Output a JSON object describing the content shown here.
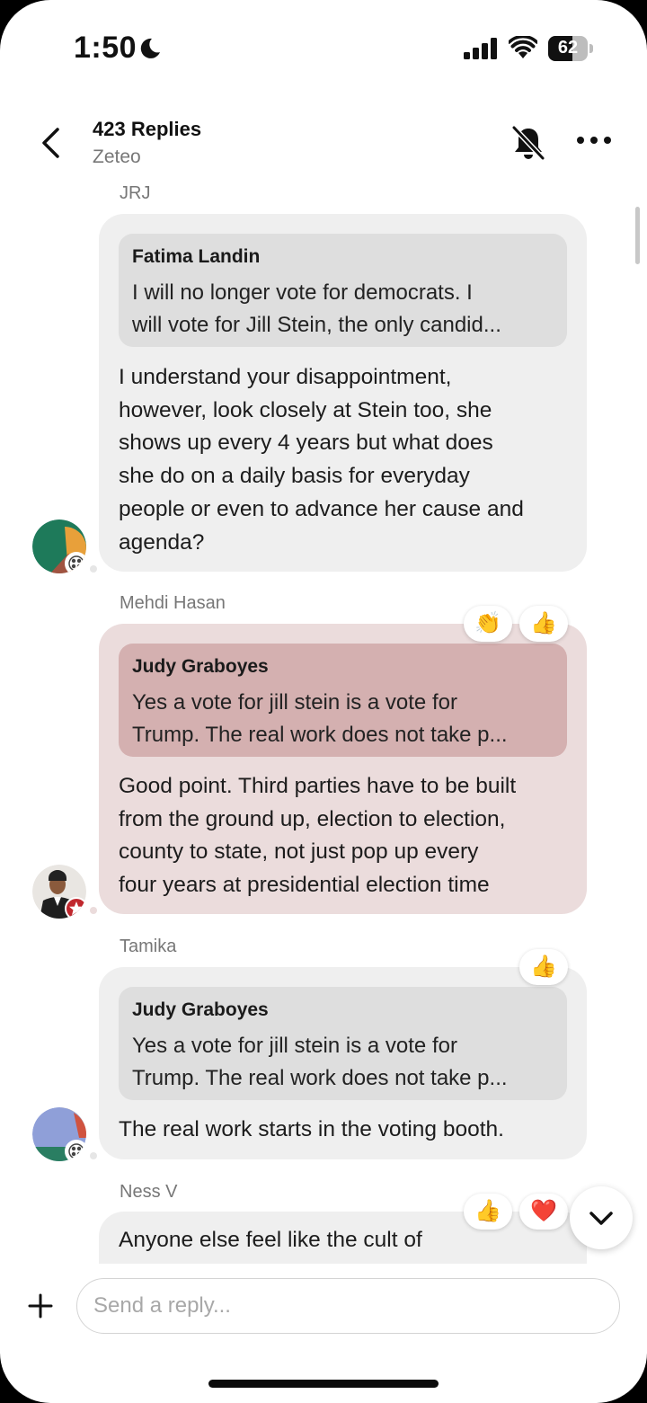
{
  "status_bar": {
    "time": "1:50",
    "battery": "62",
    "battery_level": 0.62,
    "icons": [
      "moon-icon",
      "cellular-signal-icon",
      "wifi-icon",
      "battery-icon"
    ]
  },
  "header": {
    "title": "423 Replies",
    "subtitle": "Zeteo",
    "icons": [
      "back-chevron-icon",
      "bell-muted-icon",
      "more-dots-icon"
    ]
  },
  "messages": [
    {
      "author": "JRJ",
      "quote": {
        "name": "Fatima  Landin",
        "text": "I will no longer vote for democrats. I\nwill vote for Jill Stein, the only candid..."
      },
      "body": "I understand your disappointment,\nhowever, look closely at Stein too, she\nshows up every 4 years but what does\nshe do on a daily basis for everyday\npeople or even to advance her cause and\nagenda?",
      "reactions": []
    },
    {
      "author": "Mehdi Hasan",
      "quote": {
        "name": "Judy Graboyes",
        "text": "Yes a vote for jill stein is a vote for\nTrump. The real work does not take p..."
      },
      "body": "Good point. Third parties have to be built\nfrom the ground up, election to election,\ncounty to state, not just pop up every\nfour years at presidential election time",
      "reactions": [
        "👏",
        "👍"
      ]
    },
    {
      "author": "Tamika",
      "quote": {
        "name": "Judy Graboyes",
        "text": "Yes a vote for jill stein is a vote for\nTrump. The real work does not take p..."
      },
      "body": "The real work starts in the voting booth.",
      "reactions": [
        "👍"
      ]
    },
    {
      "author": "Ness V",
      "body": "Anyone else feel like the cult of",
      "reactions": [
        "👍",
        "❤️"
      ]
    }
  ],
  "composer": {
    "placeholder": "Send a reply...",
    "value": ""
  },
  "colors": {
    "bubble": "#efefef",
    "quote": "#dedede",
    "host_bubble": "#ebdcdc",
    "host_quote": "#d4b0b0",
    "secondary_text": "#777777"
  }
}
